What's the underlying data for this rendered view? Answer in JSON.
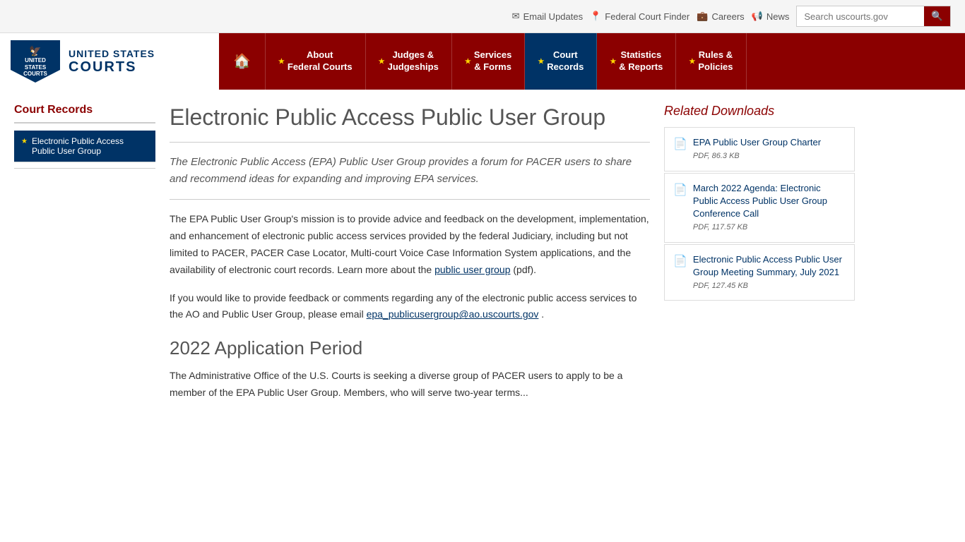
{
  "topbar": {
    "email_updates": "Email Updates",
    "federal_court_finder": "Federal Court Finder",
    "careers": "Careers",
    "news": "News",
    "search_placeholder": "Search uscourts.gov"
  },
  "header": {
    "logo_line1": "UNITED STATES",
    "logo_line2": "COURTS"
  },
  "nav": {
    "home_label": "🏠",
    "items": [
      {
        "label": "About\nFederal Courts",
        "active": false
      },
      {
        "label": "Judges &\nJudgeships",
        "active": false
      },
      {
        "label": "Services\n& Forms",
        "active": false
      },
      {
        "label": "Court\nRecords",
        "active": true
      },
      {
        "label": "Statistics\n& Reports",
        "active": false
      },
      {
        "label": "Rules &\nPolicies",
        "active": false
      }
    ]
  },
  "sidebar": {
    "title": "Court Records",
    "items": [
      {
        "label": "Electronic Public Access Public User Group"
      }
    ]
  },
  "main": {
    "page_title": "Electronic Public Access Public User Group",
    "intro_text": "The Electronic Public Access (EPA) Public User Group provides a forum for PACER users to share and recommend ideas for expanding and improving EPA services.",
    "body_paragraph1": "The EPA Public User Group's mission is to provide advice and feedback on the development, implementation, and enhancement of electronic public access services provided by the federal Judiciary, including but not limited to PACER, PACER Case Locator, Multi-court Voice Case Information System applications, and the availability of electronic court records. Learn more about the",
    "body_link1": "public user group",
    "body_paragraph1_end": "(pdf).",
    "body_paragraph2_start": "If you would like to provide feedback or comments regarding any of the electronic public access services to the AO and Public User Group, please email",
    "body_email": "epa_publicusergroup@ao.uscourts.gov",
    "body_paragraph2_end": ".",
    "section_heading": "2022 Application Period",
    "section_body": "The Administrative Office of the U.S. Courts is seeking a diverse group of PACER users to apply to be a member of the EPA Public User Group. Members, who will serve two-year terms..."
  },
  "downloads": {
    "title": "Related Downloads",
    "items": [
      {
        "label": "EPA Public User Group Charter",
        "size": "PDF, 86.3 KB"
      },
      {
        "label": "March 2022 Agenda: Electronic Public Access Public User Group Conference Call",
        "size": "PDF, 117.57 KB"
      },
      {
        "label": "Electronic Public Access Public User Group Meeting Summary, July 2021",
        "size": "PDF, 127.45 KB"
      }
    ]
  }
}
